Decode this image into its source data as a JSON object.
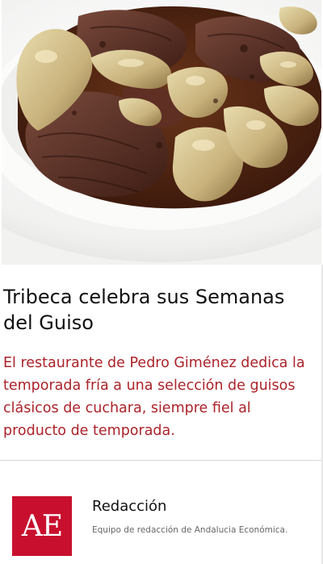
{
  "article": {
    "image_alt": "Guiso de carne con setas en plato blanco",
    "headline_line1": "Tribeca celebra sus Semanas",
    "headline_line2": "del Guiso",
    "lead_lines": [
      "El restaurante de Pedro Giménez dedica la",
      "temporada fría a una selección de guisos",
      "clásicos de cuchara, siempre fiel al",
      "producto de temporada."
    ]
  },
  "author": {
    "logo_text": "AE",
    "name": "Redacción",
    "bio": "Equipo de redacción de Andalucia Económica."
  },
  "colors": {
    "lead_text": "#ab2329",
    "logo_bg": "#c8102e",
    "sauce": "#5a2a17",
    "plate": "#f7f7f7"
  }
}
